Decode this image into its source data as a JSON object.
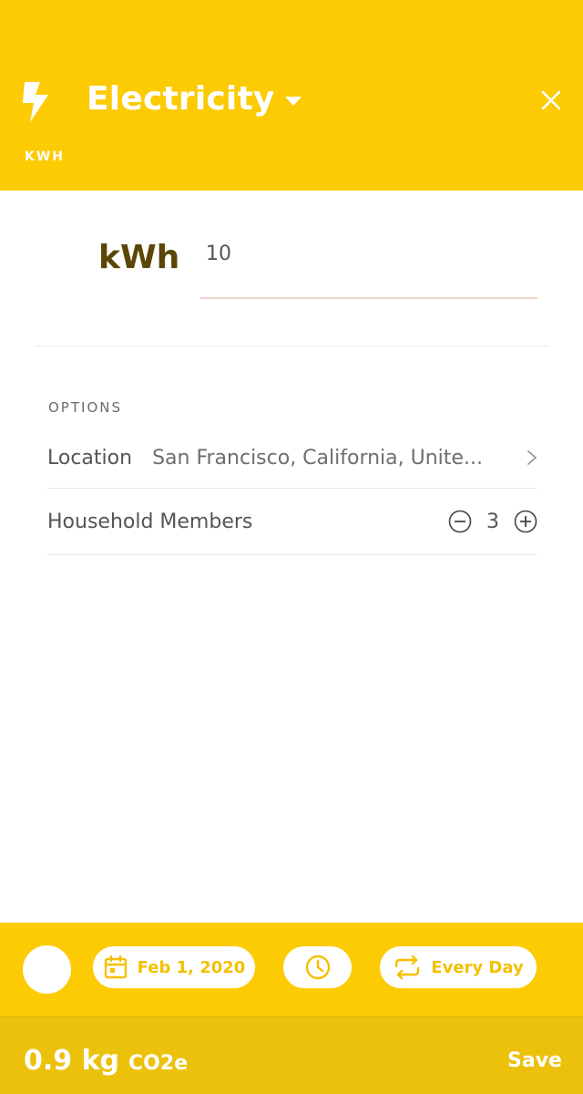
{
  "header": {
    "title": "Electricity",
    "unit_caption": "KWH",
    "icon": "bolt-icon",
    "close_icon": "close-icon",
    "background_color": "#fccb04"
  },
  "entry": {
    "unit_label": "kWh",
    "value": "10"
  },
  "options": {
    "section_label": "OPTIONS",
    "location": {
      "label": "Location",
      "value": "San Francisco, California, Unite..."
    },
    "household": {
      "label": "Household Members",
      "count": "3"
    }
  },
  "bottom_bar": {
    "date_label": "Feb 1, 2020",
    "repeat_label": "Every Day",
    "icons": [
      "calendar-icon",
      "clock-icon",
      "repeat-icon"
    ]
  },
  "footer": {
    "total_amount": "0.9 kg",
    "total_unit": "CO2e",
    "save_label": "Save",
    "background_color": "#ecc10b"
  }
}
